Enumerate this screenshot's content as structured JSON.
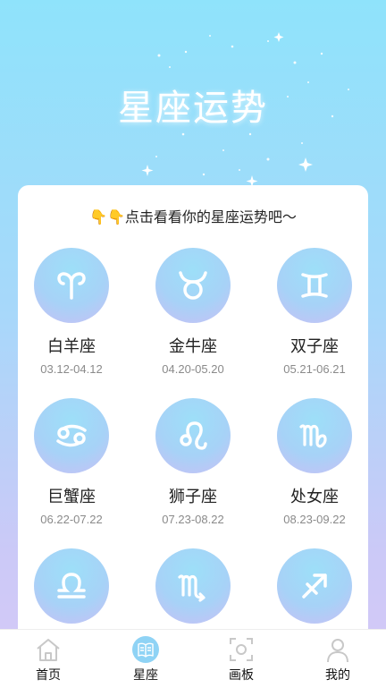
{
  "banner": {
    "title": "星座运势"
  },
  "card": {
    "prompt": "👇👇点击看看你的星座运势吧〜"
  },
  "signs": [
    {
      "name": "白羊座",
      "dates": "03.12-04.12",
      "icon": "aries-icon"
    },
    {
      "name": "金牛座",
      "dates": "04.20-05.20",
      "icon": "taurus-icon"
    },
    {
      "name": "双子座",
      "dates": "05.21-06.21",
      "icon": "gemini-icon"
    },
    {
      "name": "巨蟹座",
      "dates": "06.22-07.22",
      "icon": "cancer-icon"
    },
    {
      "name": "狮子座",
      "dates": "07.23-08.22",
      "icon": "leo-icon"
    },
    {
      "name": "处女座",
      "dates": "08.23-09.22",
      "icon": "virgo-icon"
    },
    {
      "name": "",
      "dates": "",
      "icon": "libra-icon"
    },
    {
      "name": "",
      "dates": "",
      "icon": "scorpio-icon"
    },
    {
      "name": "",
      "dates": "",
      "icon": "sagittarius-icon"
    }
  ],
  "tabbar": {
    "items": [
      {
        "label": "首页",
        "icon": "home-icon"
      },
      {
        "label": "星座",
        "icon": "book-icon",
        "active": true
      },
      {
        "label": "画板",
        "icon": "scan-frame-icon"
      },
      {
        "label": "我的",
        "icon": "person-icon"
      }
    ]
  },
  "colors": {
    "accent": "#8fd3f5",
    "bg_top": "#8fe3fb",
    "bg_bottom": "#d6c9f7"
  }
}
